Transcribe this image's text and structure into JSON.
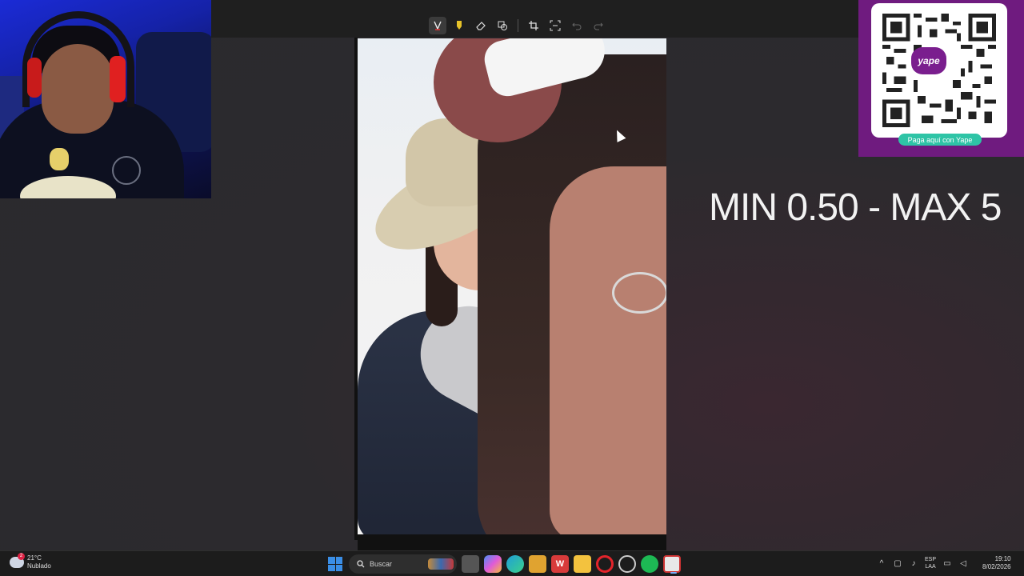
{
  "toolbar": {
    "tools": [
      {
        "name": "pen-tool",
        "icon": "pen-icon",
        "active": true
      },
      {
        "name": "highlighter-tool",
        "icon": "highlighter-icon",
        "color": "#e6c229"
      },
      {
        "name": "eraser-tool",
        "icon": "eraser-icon"
      },
      {
        "name": "shapes-tool",
        "icon": "shapes-icon"
      },
      {
        "name": "crop-tool",
        "icon": "crop-icon"
      },
      {
        "name": "text-extract-tool",
        "icon": "text-extract-icon"
      },
      {
        "name": "undo",
        "icon": "undo-icon"
      },
      {
        "name": "redo",
        "icon": "redo-icon"
      }
    ]
  },
  "overlay": {
    "donation_range": "MIN 0.50 - MAX 5"
  },
  "qr": {
    "brand": "yape",
    "pay_label": "Paga aquí con Yape",
    "brand_color": "#6f1b7f",
    "pay_color": "#2ec4a6"
  },
  "taskbar": {
    "weather": {
      "temperature": "21°C",
      "condition": "Nublado",
      "badge": "2"
    },
    "search_placeholder": "Buscar",
    "apps": [
      "file-explorer-taskview",
      "copilot",
      "edge",
      "store",
      "office",
      "folder",
      "opera",
      "chrome-like",
      "spotify",
      "snipping-tool"
    ],
    "language": {
      "lang": "ESP",
      "layout": "LAA"
    },
    "clock": {
      "time": "19:10",
      "date": "8/02/2026"
    }
  }
}
